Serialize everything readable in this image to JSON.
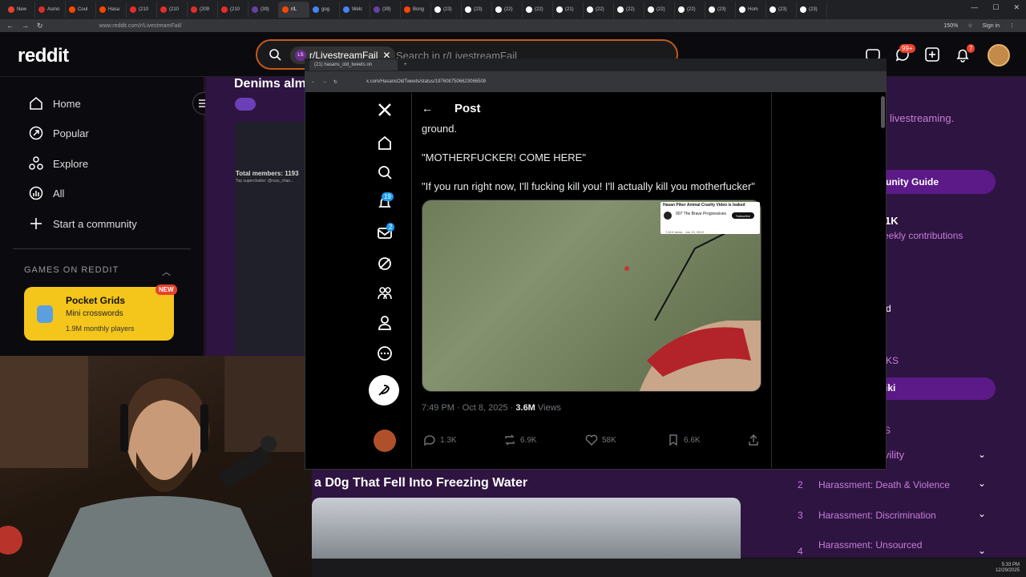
{
  "browser": {
    "tabs": [
      "New",
      "Asmo",
      "Coul",
      "Hasa",
      "(210",
      "(210",
      "(209",
      "(210",
      "(39)",
      "r/L",
      "gog",
      "Welc",
      "(39)",
      "Bong",
      "(23)",
      "(23)",
      "(22)",
      "(22)",
      "(21)",
      "(22)",
      "(22)",
      "(22)",
      "(22)",
      "(23)",
      "Hom",
      "(23)",
      "(23)"
    ],
    "active_tab_index": 9,
    "url": "www.reddit.com/r/LivestreamFail/",
    "zoom": "150%",
    "sign_in": "Sign in"
  },
  "reddit": {
    "logo": "reddit",
    "search": {
      "chip_avatar": "LS",
      "chip": "r/LivestreamFail",
      "placeholder": "Search in r/LivestreamFail"
    },
    "chat_badge": "99+",
    "notif_badge": "7",
    "sidebar": {
      "items": [
        {
          "label": "Home",
          "icon": "home-icon"
        },
        {
          "label": "Popular",
          "icon": "popular-icon"
        },
        {
          "label": "Explore",
          "icon": "explore-icon"
        },
        {
          "label": "All",
          "icon": "all-icon"
        },
        {
          "label": "Start a community",
          "icon": "plus-icon"
        }
      ],
      "games_header": "GAMES ON REDDIT",
      "game": {
        "title": "Pocket Grids",
        "subtitle": "Mini crosswords",
        "players": "1.9M monthly players",
        "badge": "NEW"
      }
    },
    "post1": {
      "title": "Denims alm",
      "members": "Total members: 1193",
      "superchat": "Top superchatter: @russ_chan..."
    },
    "post2": {
      "title": "a D0g That Fell Into Freezing Water"
    },
    "right_sidebar": {
      "livestreaming": "livestreaming.",
      "guide": "unity Guide",
      "members": "1K",
      "weekly": "eekly contributions",
      "d_text": "d",
      "ks": "KS",
      "wiki": "iki",
      "s_text": "S",
      "civility": "ivility",
      "rules": [
        {
          "num": "2",
          "label": "Harassment: Death & Violence"
        },
        {
          "num": "3",
          "label": "Harassment: Discrimination"
        },
        {
          "num": "4",
          "label": "Harassment: Unsourced"
        }
      ]
    }
  },
  "x_window": {
    "tab_title": "(21) hasans_old_tweets on",
    "url": "x.com/HasansOldTweets/status/1976087506623066509",
    "header": "Post",
    "notif_badge": "19",
    "msg_badge": "2",
    "tweet_lines": [
      "ground.",
      "\"MOTHERFUCKER! COME HERE\"",
      "\"If you run right now, I'll fucking kill you! I'll actually kill you motherfucker\""
    ],
    "video_overlay": {
      "title": "Hasan Piker Animal Cruelty Video is leaked",
      "channel": "007 The Brave Progressives",
      "subscribe": "Subscribe",
      "views": "7,619 views · Jun 10, 2019"
    },
    "meta_time": "7:49 PM · Oct 8, 2025 · ",
    "meta_views": "3.6M",
    "meta_views_label": " Views",
    "actions": {
      "replies": "1.3K",
      "reposts": "6.9K",
      "likes": "58K",
      "bookmarks": "6.6K"
    }
  },
  "taskbar": {
    "time": "5:33 PM",
    "date": "12/29/2025"
  }
}
